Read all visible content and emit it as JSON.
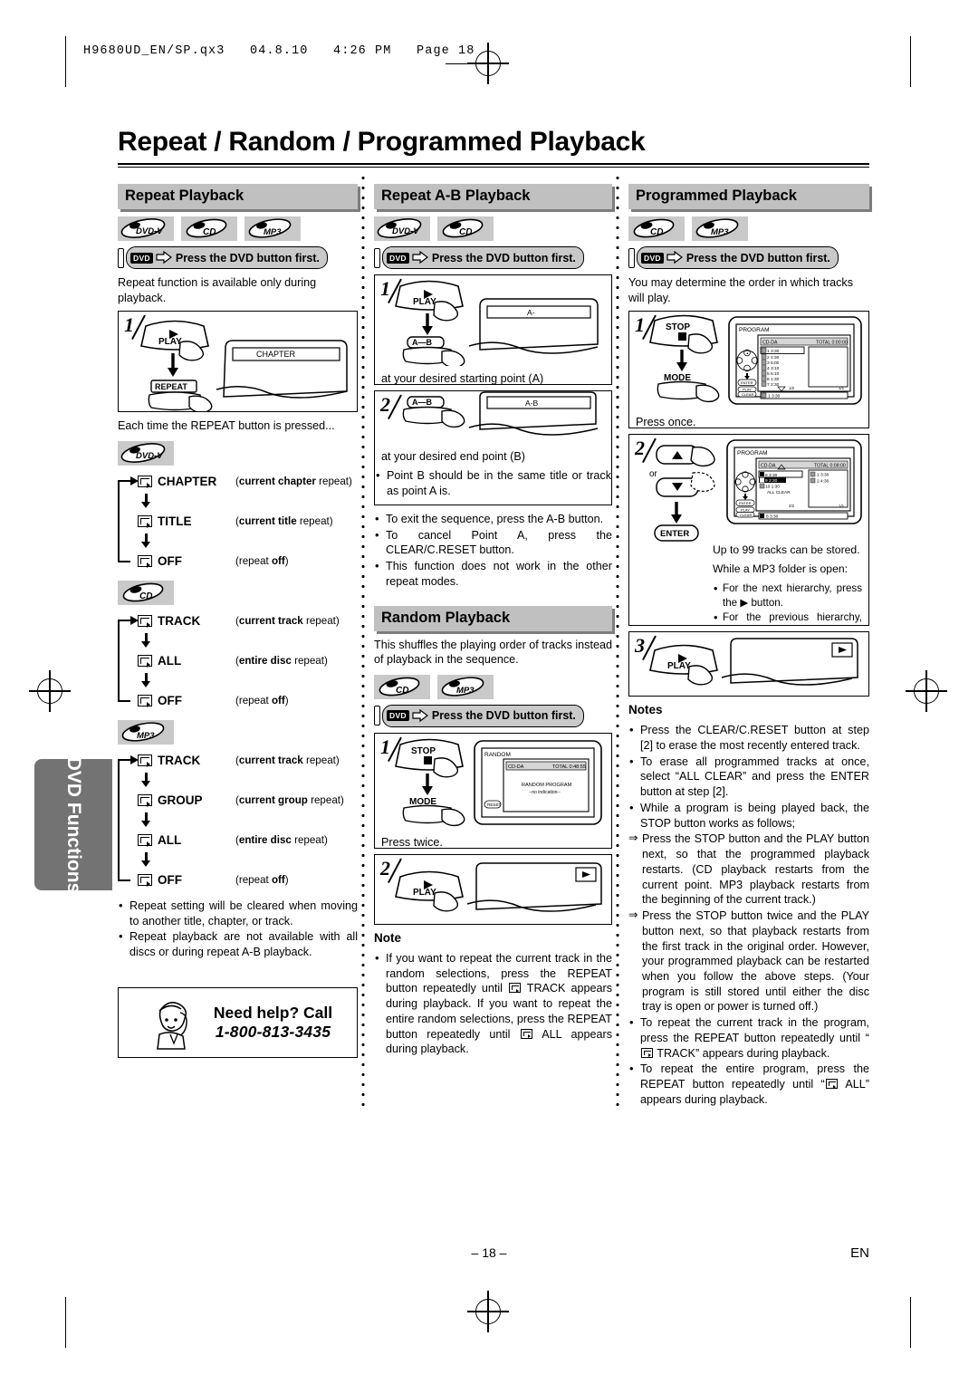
{
  "slug": "H9680UD_EN/SP.qx3   04.8.10   4:26 PM   Page 18",
  "title": "Repeat / Random / Programmed Playback",
  "side_tab": "DVD Functions",
  "footer": {
    "page_number": "– 18 –",
    "language_code": "EN"
  },
  "dvd_button_note": "Press the DVD button first.",
  "dvd_tag": "DVD",
  "disc_labels": {
    "dvdv": "DVD-V",
    "cd": "CD",
    "mp3": "MP3"
  },
  "column1": {
    "heading": "Repeat Playback",
    "discs": [
      "DVD-V",
      "CD",
      "MP3"
    ],
    "intro": "Repeat function is available only during playback.",
    "step1": {
      "num": "1",
      "play": "PLAY",
      "repeat": "REPEAT",
      "osd": "CHAPTER"
    },
    "after_step": "Each time the REPEAT button is pressed...",
    "cycles": [
      {
        "disc": "DVD-V",
        "items": [
          {
            "label": "CHAPTER",
            "desc_bold": "current chapter",
            "desc_rest": " repeat"
          },
          {
            "label": "TITLE",
            "desc_bold": "current title",
            "desc_rest": " repeat"
          },
          {
            "label": "OFF",
            "desc_pre": "repeat ",
            "desc_bold2": "off"
          }
        ]
      },
      {
        "disc": "CD",
        "items": [
          {
            "label": "TRACK",
            "desc_bold": "current track",
            "desc_rest": " repeat"
          },
          {
            "label": "ALL",
            "desc_bold": "entire disc",
            "desc_rest": " repeat"
          },
          {
            "label": "OFF",
            "desc_pre": "repeat ",
            "desc_bold2": "off"
          }
        ]
      },
      {
        "disc": "MP3",
        "items": [
          {
            "label": "TRACK",
            "desc_bold": "current track",
            "desc_rest": " repeat"
          },
          {
            "label": "GROUP",
            "desc_bold": "current group",
            "desc_rest": " repeat"
          },
          {
            "label": "ALL",
            "desc_bold": "entire disc",
            "desc_rest": " repeat"
          },
          {
            "label": "OFF",
            "desc_pre": "repeat ",
            "desc_bold2": "off"
          }
        ]
      }
    ],
    "bullets": [
      "Repeat setting will be cleared when moving to another title, chapter, or track.",
      "Repeat playback are not available with all discs or during repeat A-B playback."
    ],
    "help": {
      "line1": "Need help? Call",
      "line2": "1-800-813-3435"
    }
  },
  "column2": {
    "heading": "Repeat A-B Playback",
    "discs": [
      "DVD-V",
      "CD"
    ],
    "step1": {
      "num": "1",
      "play": "PLAY",
      "ab": "A–B",
      "osd": "A-",
      "caption": "at your desired starting point (A)"
    },
    "step2": {
      "num": "2",
      "ab": "A–B",
      "osd": "A-B",
      "caption": "at your desired end point (B)",
      "bullet": "Point B should be in the same title or track as point A is."
    },
    "bullets": [
      "To exit the sequence, press the A-B button.",
      "To cancel Point A, press the CLEAR/C.RESET button.",
      "This function does not work in the other repeat modes."
    ],
    "random": {
      "heading": "Random Playback",
      "intro": "This shuffles the playing order of tracks instead of playback in the sequence.",
      "discs": [
        "CD",
        "MP3"
      ],
      "step1": {
        "num": "1",
        "stop": "STOP",
        "mode": "MODE",
        "caption": "Press twice."
      },
      "step2": {
        "num": "2",
        "play": "PLAY"
      },
      "osd": {
        "title": "RANDOM",
        "disc_type": "CD-DA",
        "total_label": "TOTAL 0:48:55",
        "line1": "RANDOM PROGRAM",
        "line2": "--no indication--",
        "button": "RESET"
      },
      "note_head": "Note",
      "note_parts": {
        "p1": "If you want to repeat the current track in the random selections, press the REPEAT button repeatedly until ",
        "p2": " TRACK appears during playback. If you want to repeat the entire random selections, press the REPEAT button repeatedly until ",
        "p3": " ALL appears during playback."
      }
    }
  },
  "column3": {
    "heading": "Programmed Playback",
    "discs": [
      "CD",
      "MP3"
    ],
    "intro": "You may determine the order in which tracks will play.",
    "step1": {
      "num": "1",
      "stop": "STOP",
      "mode": "MODE",
      "caption": "Press once.",
      "osd": {
        "title": "PROGRAM",
        "disc_type": "CD-DA",
        "total": "TOTAL 0:00:00",
        "tracks": [
          {
            "no": "1",
            "time": "3:30"
          },
          {
            "no": "2",
            "time": "4:30"
          },
          {
            "no": "3",
            "time": "5:00"
          },
          {
            "no": "4",
            "time": "3:10"
          },
          {
            "no": "5",
            "time": "5:10"
          },
          {
            "no": "6",
            "time": "1:30"
          },
          {
            "no": "7",
            "time": "2:30"
          }
        ],
        "page_left": "1/2",
        "page_right": "1/1",
        "selection": "1   3:30",
        "btn_enter": "ENTER",
        "btn_play": "PLAY",
        "btn_clear": "CLEAR"
      }
    },
    "step2": {
      "num": "2",
      "or": "or",
      "enter": "ENTER",
      "note": "Up to 99 tracks can be stored.",
      "mp3_head": "While a MP3 folder is open:",
      "mp3_bullets": [
        "For the next hierarchy, press the ▶ button.",
        "For the previous hierarchy, press the ◀ button."
      ],
      "osd": {
        "title": "PROGRAM",
        "disc_type": "CD-DA",
        "total": "TOTAL 0:08:00",
        "tracks": [
          {
            "no": "8",
            "time": "3:30"
          },
          {
            "no": "9",
            "time": "2:30"
          },
          {
            "no": "10",
            "time": "1:30"
          }
        ],
        "all_clear": "ALL CLEAR",
        "programmed": [
          {
            "no": "1",
            "time": "3:30"
          },
          {
            "no": "2",
            "time": "4:30"
          }
        ],
        "page_left": "2/2",
        "page_right": "1/1",
        "selection": "8   3:30"
      }
    },
    "step3": {
      "num": "3",
      "play": "PLAY"
    },
    "notes_head": "Notes",
    "notes": [
      {
        "type": "bullet",
        "text": "Press the CLEAR/C.RESET button at step [2] to erase the most recently entered track."
      },
      {
        "type": "bullet",
        "text": "To erase all programmed tracks at once, select “ALL CLEAR” and press the ENTER button at step [2]."
      },
      {
        "type": "bullet",
        "text": "While a program is being played back, the STOP button works as follows;"
      },
      {
        "type": "arrow",
        "text": "Press the STOP button and the PLAY button next, so that the programmed playback restarts. (CD playback restarts from the current point. MP3 playback restarts from the beginning of the current track.)"
      },
      {
        "type": "arrow",
        "text": "Press the STOP button twice and the PLAY button next, so that playback restarts from the first track in the original order. However, your programmed playback can be restarted when you follow the above steps. (Your program is still stored until either the disc tray is open or power is turned off.)"
      }
    ],
    "note_repeat_track": {
      "p1": "To repeat the current track in the program, press the REPEAT button repeatedly until “",
      "p2": " TRACK” appears during playback."
    },
    "note_repeat_all": {
      "p1": "To repeat the entire program, press the REPEAT button repeatedly until “",
      "p2": " ALL” appears during playback."
    }
  }
}
